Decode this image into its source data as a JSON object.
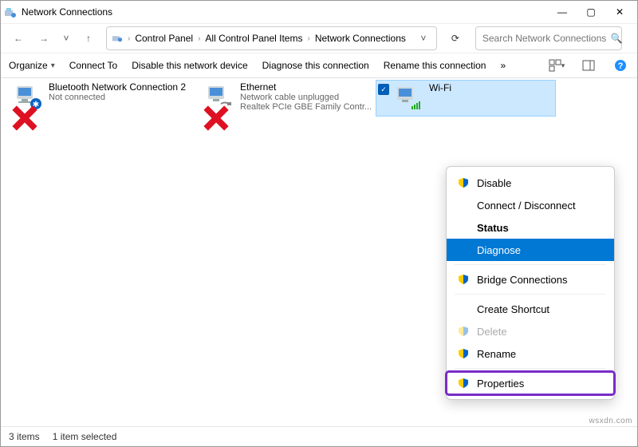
{
  "title": "Network Connections",
  "window_buttons": {
    "min": "—",
    "max": "▢",
    "close": "✕"
  },
  "nav": {
    "back": "←",
    "forward": "→",
    "up": "↑",
    "chev": "˅",
    "refresh": "⟳"
  },
  "breadcrumb": [
    "Control Panel",
    "All Control Panel Items",
    "Network Connections"
  ],
  "search": {
    "placeholder": "Search Network Connections"
  },
  "commands": {
    "organize": "Organize",
    "connect": "Connect To",
    "disable": "Disable this network device",
    "diagnose": "Diagnose this connection",
    "rename": "Rename this connection",
    "more": "»"
  },
  "items": [
    {
      "name": "Bluetooth Network Connection 2",
      "status": "Not connected"
    },
    {
      "name": "Ethernet",
      "status": "Network cable unplugged",
      "detail": "Realtek PCIe GBE Family Contr..."
    },
    {
      "name": "Wi-Fi",
      "status": ""
    }
  ],
  "context_menu": {
    "disable": "Disable",
    "connect": "Connect / Disconnect",
    "status": "Status",
    "diagnose": "Diagnose",
    "bridge": "Bridge Connections",
    "shortcut": "Create Shortcut",
    "delete": "Delete",
    "rename": "Rename",
    "properties": "Properties"
  },
  "statusbar": {
    "count": "3 items",
    "selected": "1 item selected"
  },
  "watermark": "wsxdn.com"
}
